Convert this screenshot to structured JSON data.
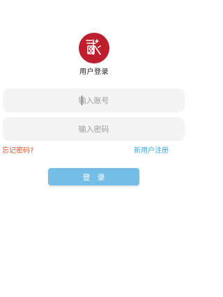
{
  "app": {
    "title": "用户登录",
    "brand_color": "#bd1f2d"
  },
  "form": {
    "account": {
      "value": "",
      "placeholder": "输入账号"
    },
    "password": {
      "value": "",
      "placeholder": "输入密码"
    }
  },
  "links": {
    "forgot_password": "忘记密码?",
    "register": "新用户注册",
    "forgot_color": "#d9542b",
    "register_color": "#3aa8dc"
  },
  "actions": {
    "login_label": "登录",
    "login_color": "#74bde6"
  },
  "icons": {
    "logo": "app-logo-icon"
  }
}
